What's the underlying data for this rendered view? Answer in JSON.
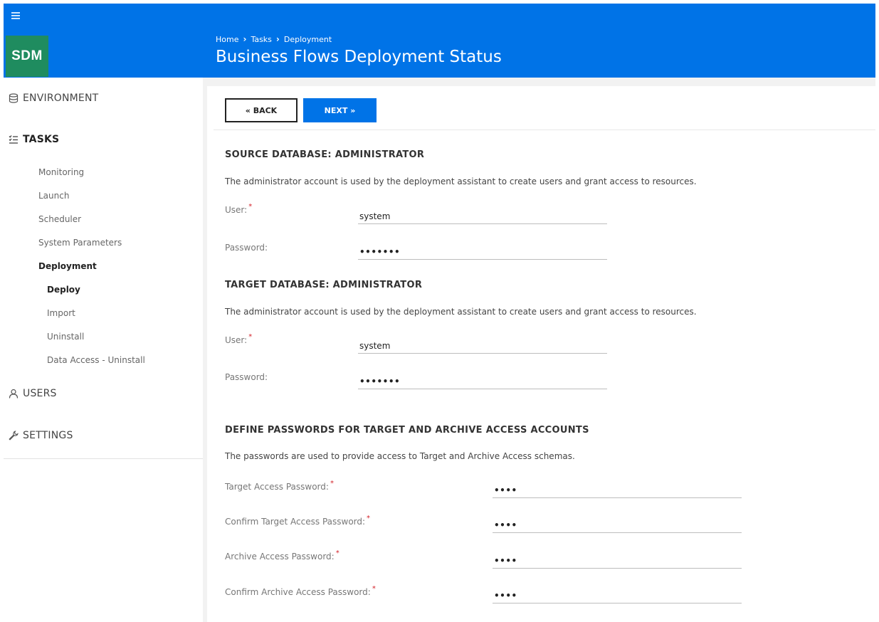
{
  "header": {
    "logo": "SDM",
    "breadcrumb": [
      "Home",
      "Tasks",
      "Deployment"
    ],
    "title": "Business Flows Deployment Status"
  },
  "sidebar": {
    "environment": "ENVIRONMENT",
    "tasks": "TASKS",
    "task_items": [
      "Monitoring",
      "Launch",
      "Scheduler",
      "System Parameters",
      "Deployment"
    ],
    "deployment_items": [
      "Deploy",
      "Import",
      "Uninstall",
      "Data Access - Uninstall"
    ],
    "users": "USERS",
    "settings": "SETTINGS"
  },
  "toolbar": {
    "back_label": "« BACK",
    "next_label": "NEXT »"
  },
  "source": {
    "title": "SOURCE DATABASE: ADMINISTRATOR",
    "desc": "The administrator account is used by the deployment assistant to create users and grant access to resources.",
    "user_label": "User:",
    "user_value": "system",
    "password_label": "Password:",
    "password_value": "•••••••"
  },
  "target": {
    "title": "TARGET DATABASE: ADMINISTRATOR",
    "desc": "The administrator account is used by the deployment assistant to create users and grant access to resources.",
    "user_label": "User:",
    "user_value": "system",
    "password_label": "Password:",
    "password_value": "•••••••"
  },
  "access": {
    "title": "DEFINE PASSWORDS FOR TARGET AND ARCHIVE ACCESS ACCOUNTS",
    "desc": "The passwords are used to provide access to Target and Archive Access schemas.",
    "fields": [
      {
        "label": "Target Access Password:",
        "value": "••••"
      },
      {
        "label": "Confirm Target Access Password:",
        "value": "••••"
      },
      {
        "label": "Archive Access Password:",
        "value": "••••"
      },
      {
        "label": "Confirm Archive Access Password:",
        "value": "••••"
      }
    ]
  },
  "required_mark": "*",
  "colors": {
    "brand_blue": "#0073e7",
    "logo_green": "#1f8c5f",
    "required_red": "#d3222a"
  }
}
